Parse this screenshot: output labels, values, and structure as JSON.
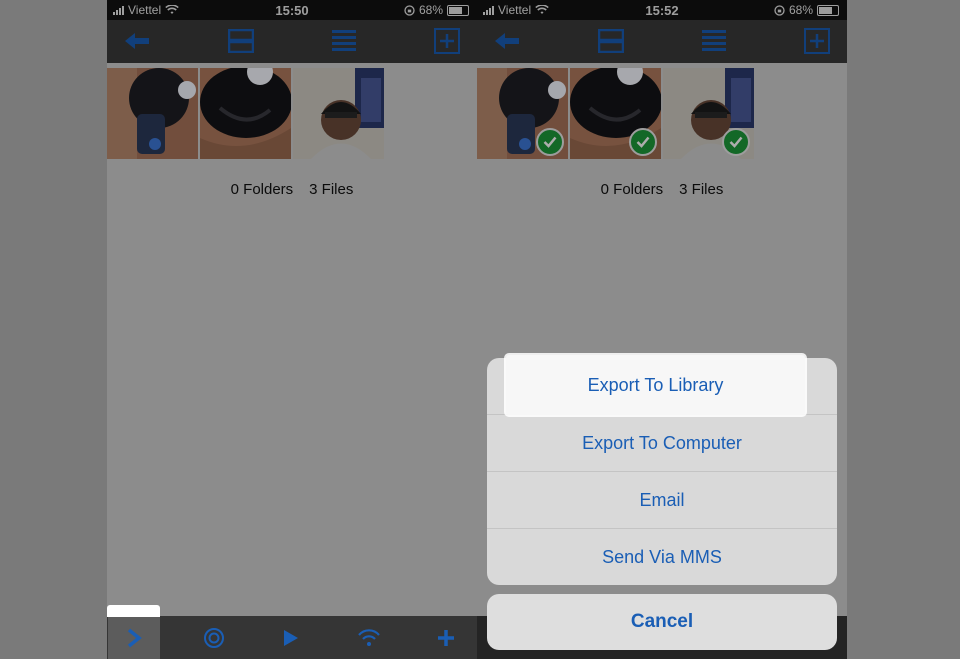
{
  "status": {
    "left": {
      "carrier": "Viettel",
      "time": "15:50",
      "battery": "68%"
    },
    "right": {
      "carrier": "Viettel",
      "time": "15:52",
      "battery": "68%"
    }
  },
  "navbar": {
    "icons": [
      "back-arrow-icon",
      "grid-view-icon",
      "list-view-icon",
      "add-folder-icon"
    ]
  },
  "content": {
    "folders": "0 Folders",
    "files": "3 Files"
  },
  "tabbar": {
    "icons": [
      "chevron-right-icon",
      "record-icon",
      "play-icon",
      "wifi-icon",
      "plus-icon"
    ]
  },
  "sheet": {
    "items": [
      "Export To Library",
      "Export To Computer",
      "Email",
      "Send Via MMS"
    ],
    "cancel": "Cancel"
  },
  "colors": {
    "accent": "#1a5eb5",
    "check": "#1d9a3a"
  }
}
